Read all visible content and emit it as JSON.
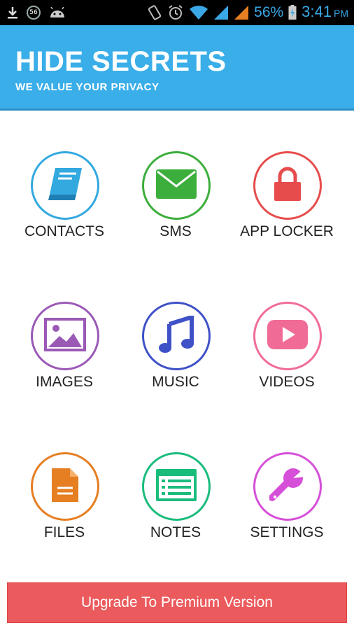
{
  "status_bar": {
    "notification_badge": "56",
    "battery": "56%",
    "time": "3:41",
    "ampm": "PM"
  },
  "header": {
    "title": "HIDE SECRETS",
    "subtitle": "WE VALUE YOUR PRIVACY",
    "color": "#3aaee8"
  },
  "tiles": [
    {
      "label": "CONTACTS",
      "icon": "book-icon",
      "color": "#33a9e0"
    },
    {
      "label": "SMS",
      "icon": "envelope-icon",
      "color": "#3cae3c"
    },
    {
      "label": "APP LOCKER",
      "icon": "lock-icon",
      "color": "#e74c4c"
    },
    {
      "label": "IMAGES",
      "icon": "image-icon",
      "color": "#9b59b6"
    },
    {
      "label": "MUSIC",
      "icon": "music-note-icon",
      "color": "#3f51c7"
    },
    {
      "label": "VIDEOS",
      "icon": "play-video-icon",
      "color": "#f06c96"
    },
    {
      "label": "FILES",
      "icon": "file-icon",
      "color": "#e67e22"
    },
    {
      "label": "NOTES",
      "icon": "notes-icon",
      "color": "#1abc7c"
    },
    {
      "label": "SETTINGS",
      "icon": "wrench-icon",
      "color": "#d64fd8"
    }
  ],
  "upgrade": {
    "label": "Upgrade To Premium Version",
    "color": "#eb5a5c"
  }
}
